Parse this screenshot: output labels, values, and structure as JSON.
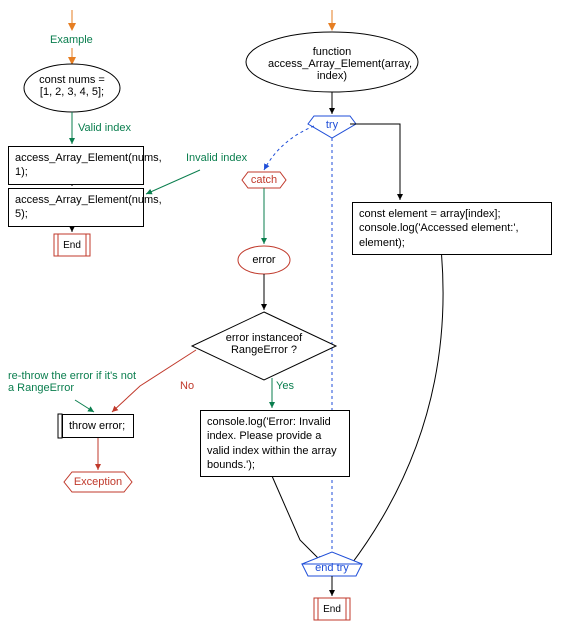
{
  "example": {
    "title": "Example",
    "const_decl": "const nums = [1, 2, 3, 4, 5];",
    "valid_label": "Valid index",
    "invalid_label": "Invalid index",
    "call1": "access_Array_Element(nums, 1);",
    "call2": "access_Array_Element(nums, 5);"
  },
  "fn": {
    "signature": "function access_Array_Element(array, index)"
  },
  "try_kw": "try",
  "catch_kw": "catch",
  "error_obj": "error",
  "instanceof_q": "error instanceof RangeError ?",
  "no_label": "No",
  "yes_label": "Yes",
  "throw_stmt": "throw error;",
  "rethrow_note": "re-throw the error if it's not a RangeError",
  "log_error": "console.log('Error: Invalid index. Please provide a valid index within the array bounds.');",
  "try_body": "const element = array[index];\nconsole.log('Accessed element:', element);",
  "end_try": "end try",
  "end_label": "End",
  "exception_label": "Exception"
}
